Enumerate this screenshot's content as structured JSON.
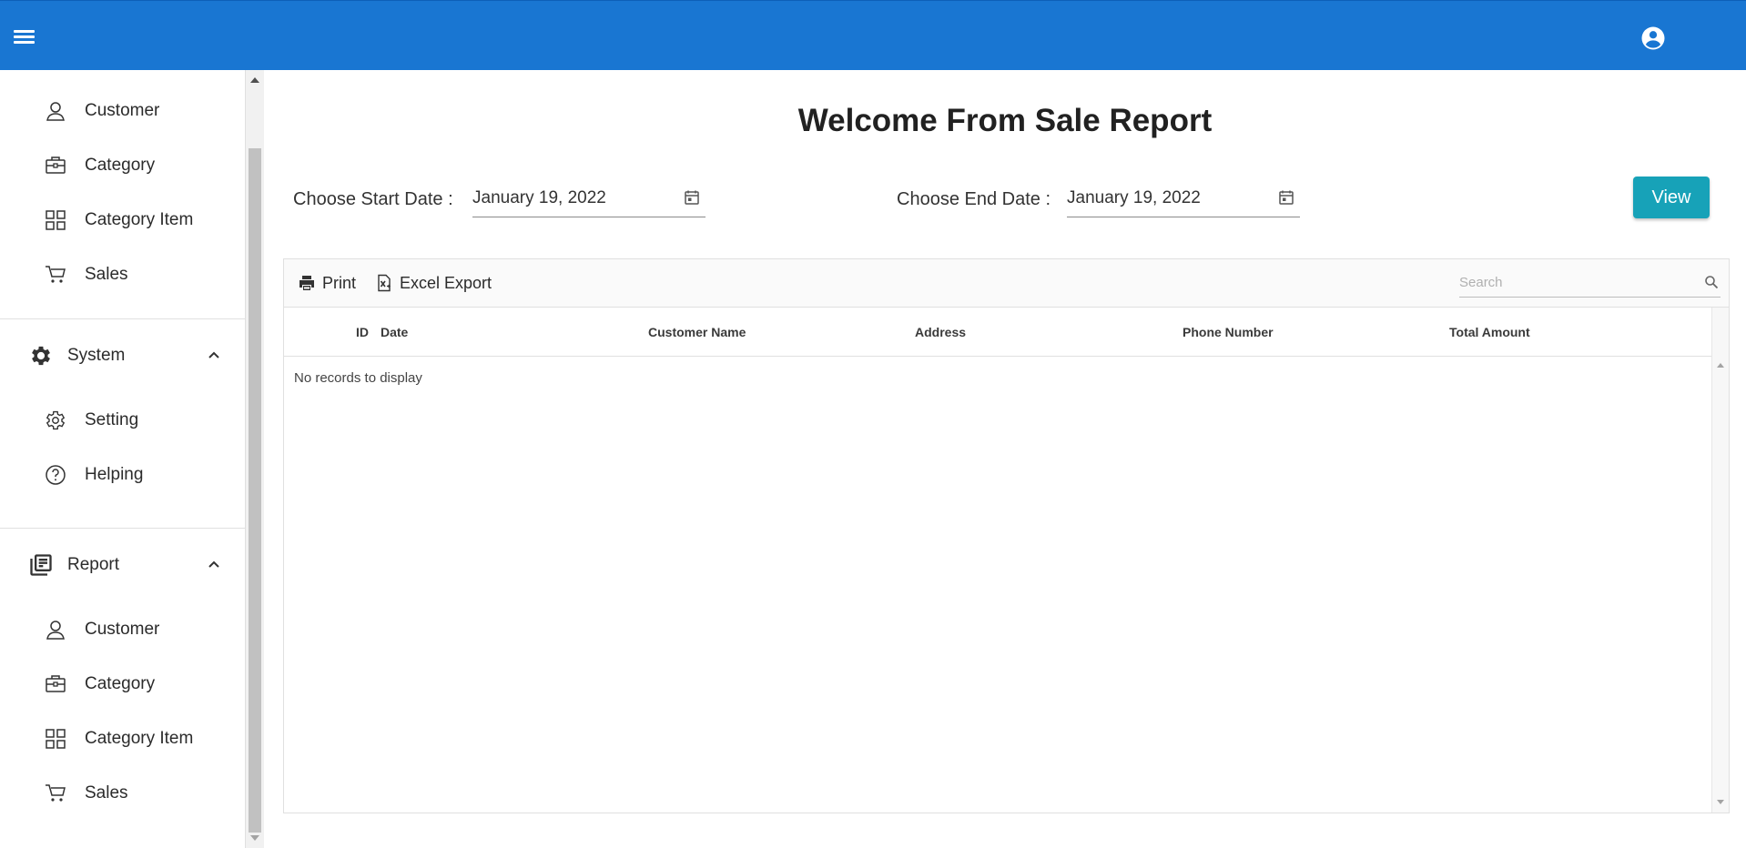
{
  "topbar": {
    "menu_icon": "hamburger-menu-icon",
    "account_icon": "account-circle-icon",
    "color": "#1976d2"
  },
  "sidebar": {
    "items_top": [
      {
        "label": "Customer",
        "icon": "person-outline-icon"
      },
      {
        "label": "Category",
        "icon": "briefcase-icon"
      },
      {
        "label": "Category Item",
        "icon": "grid-icon"
      },
      {
        "label": "Sales",
        "icon": "cart-icon"
      }
    ],
    "system": {
      "label": "System",
      "icon": "gear-filled-icon",
      "expanded": true,
      "items": [
        {
          "label": "Setting",
          "icon": "gear-outline-icon"
        },
        {
          "label": "Helping",
          "icon": "help-circle-icon"
        }
      ]
    },
    "report": {
      "label": "Report",
      "icon": "report-library-icon",
      "expanded": true,
      "items": [
        {
          "label": "Customer",
          "icon": "person-outline-icon"
        },
        {
          "label": "Category",
          "icon": "briefcase-icon"
        },
        {
          "label": "Category Item",
          "icon": "grid-icon"
        },
        {
          "label": "Sales",
          "icon": "cart-icon"
        }
      ]
    }
  },
  "main": {
    "title": "Welcome From Sale Report",
    "start_date": {
      "label": "Choose Start Date :",
      "value": "January 19, 2022"
    },
    "end_date": {
      "label": "Choose End Date :",
      "value": "January 19, 2022"
    },
    "view_button": "View",
    "accent": "#17a2b8"
  },
  "grid": {
    "toolbar": {
      "print_label": "Print",
      "excel_label": "Excel Export"
    },
    "search": {
      "placeholder": "Search",
      "value": ""
    },
    "columns": [
      "ID",
      "Date",
      "Customer Name",
      "Address",
      "Phone Number",
      "Total Amount"
    ],
    "empty_message": "No records to display"
  }
}
